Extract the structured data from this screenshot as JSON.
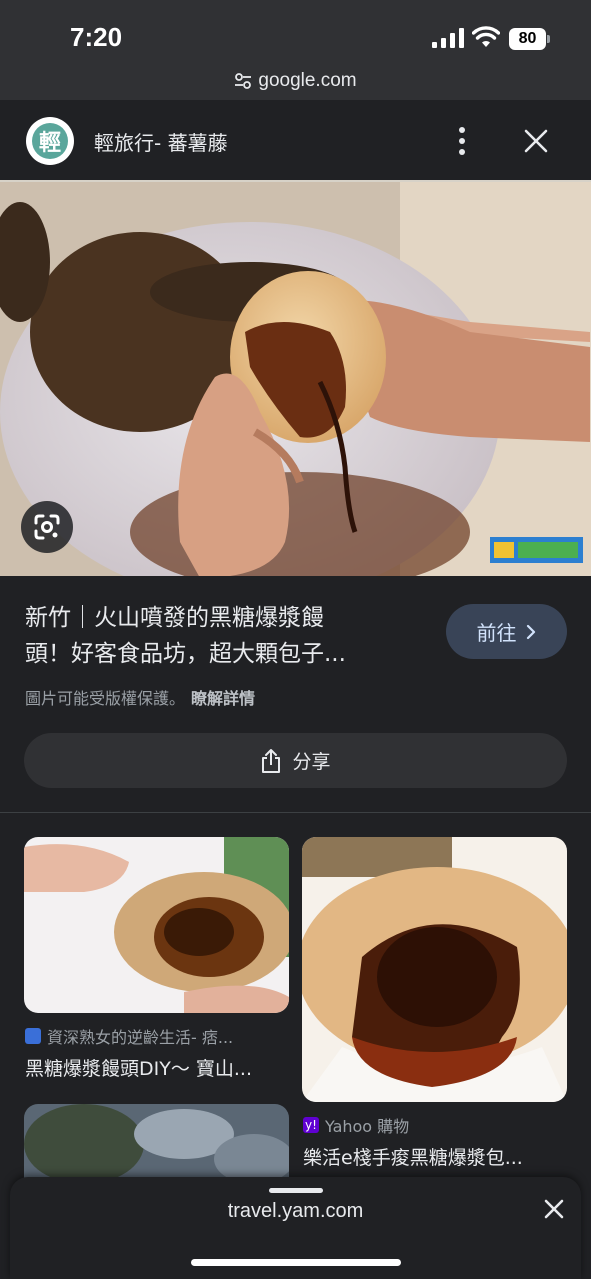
{
  "status_bar": {
    "time": "7:20",
    "battery": "80"
  },
  "url_bar": {
    "domain": "google.com"
  },
  "site": {
    "logo_char": "輕",
    "name": "輕旅行- 蕃薯藤"
  },
  "result": {
    "title_line1": "新竹｜火山噴發的黑糖爆漿饅",
    "title_line2": "頭！好客食品坊，超大顆包子...",
    "visit_label": "前往",
    "copyright_notice": "圖片可能受版權保護。",
    "copyright_link": "瞭解詳情",
    "share_label": "分享"
  },
  "related": [
    {
      "source": "資深熟女的逆齡生活- 痞...",
      "title": "黑糖爆漿饅頭DIY～ 寶山...",
      "icon_color": "#3a6fd8"
    },
    {
      "source": "Yahoo 購物",
      "title": "樂活e棧手痠黑糖爆漿包...",
      "icon_color": "#6001d2"
    }
  ],
  "bottom_sheet": {
    "url": "travel.yam.com"
  },
  "colors": {
    "accent_button": "#394457",
    "background": "#202124"
  }
}
